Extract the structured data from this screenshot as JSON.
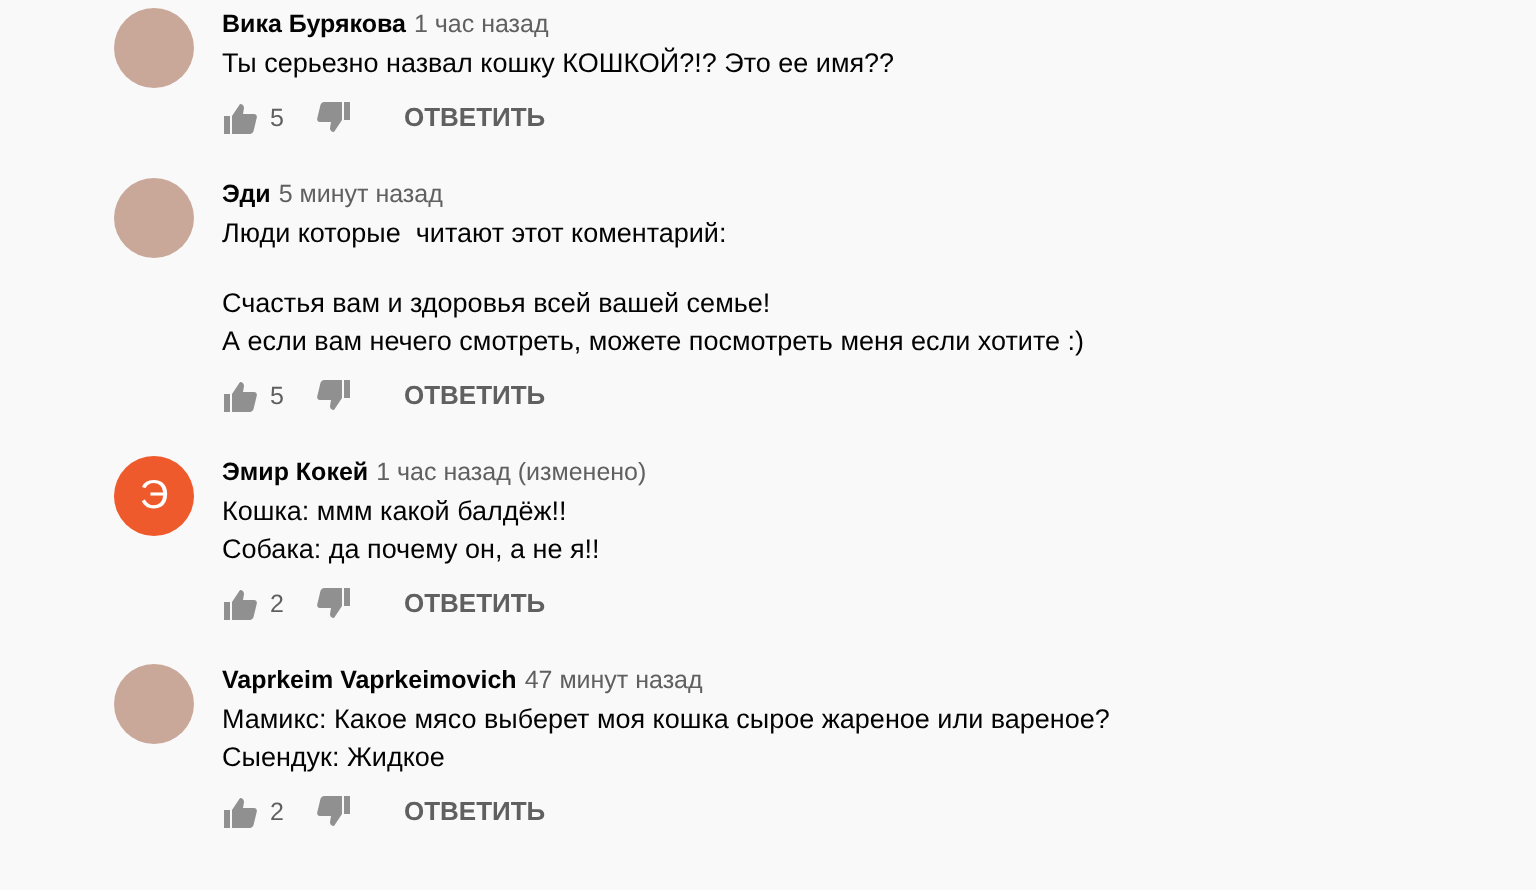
{
  "comments": [
    {
      "author": "Вика Бурякова",
      "time": "1 час назад",
      "avatar": {
        "kind": "image"
      },
      "paragraphs": [
        [
          "Ты серьезно назвал кошку КОШКОЙ?!? Это ее имя??"
        ]
      ],
      "likes": "5",
      "reply": "ОТВЕТИТЬ"
    },
    {
      "author": "Эди",
      "time": "5 минут назад",
      "avatar": {
        "kind": "image"
      },
      "paragraphs": [
        [
          "Люди которые  читают этот коментарий:"
        ],
        [
          "Счастья вам и здоровья всей вашей семье!",
          "А если вам нечего смотреть, можете посмотреть меня если хотите :)"
        ]
      ],
      "likes": "5",
      "reply": "ОТВЕТИТЬ"
    },
    {
      "author": "Эмир Кокей",
      "time": "1 час назад (изменено)",
      "avatar": {
        "kind": "letter",
        "letter": "Э",
        "color": "#ef5a2c"
      },
      "paragraphs": [
        [
          "Кошка: ммм какой балдёж!!",
          "Собака: да почему он, а не я!!"
        ]
      ],
      "likes": "2",
      "reply": "ОТВЕТИТЬ"
    },
    {
      "author": "Vaprkeim Vaprkeimovich",
      "time": "47 минут назад",
      "avatar": {
        "kind": "image"
      },
      "paragraphs": [
        [
          "Мамикс: Какое мясо выберет моя кошка сырое жареное или вареное?",
          "Сыендук: Жидкое"
        ]
      ],
      "likes": "2",
      "reply": "ОТВЕТИТЬ"
    }
  ]
}
